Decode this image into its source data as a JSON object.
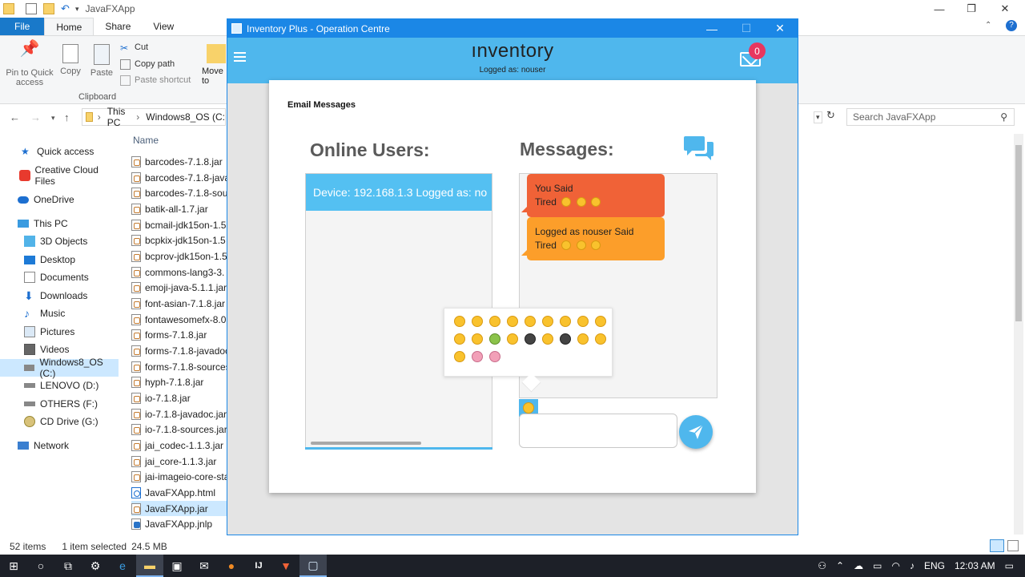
{
  "explorer": {
    "window_title": "JavaFXApp",
    "tabs": [
      {
        "label": "File"
      },
      {
        "label": "Home"
      },
      {
        "label": "Share"
      },
      {
        "label": "View"
      }
    ],
    "ribbon": {
      "pin_label": "Pin to Quick access",
      "copy_label": "Copy",
      "paste_label": "Paste",
      "cut_label": "Cut",
      "copy_path_label": "Copy path",
      "paste_shortcut_label": "Paste shortcut",
      "move_to_label": "Move to",
      "clipboard_group": "Clipboard"
    },
    "address": {
      "crumbs": [
        "This PC",
        "Windows8_OS (C:"
      ],
      "search_placeholder": "Search JavaFXApp"
    },
    "nav_items": [
      {
        "label": "Quick access",
        "icon": "star-icon"
      },
      {
        "label": "Creative Cloud Files",
        "icon": "creative-cloud-icon"
      },
      {
        "label": "OneDrive",
        "icon": "cloud-icon"
      },
      {
        "label": "This PC",
        "icon": "computer-icon"
      },
      {
        "label": "3D Objects",
        "icon": "cube-icon"
      },
      {
        "label": "Desktop",
        "icon": "desktop-icon"
      },
      {
        "label": "Documents",
        "icon": "document-icon"
      },
      {
        "label": "Downloads",
        "icon": "download-icon"
      },
      {
        "label": "Music",
        "icon": "music-icon"
      },
      {
        "label": "Pictures",
        "icon": "picture-icon"
      },
      {
        "label": "Videos",
        "icon": "video-icon"
      },
      {
        "label": "Windows8_OS (C:)",
        "icon": "drive-icon"
      },
      {
        "label": "LENOVO (D:)",
        "icon": "drive-icon"
      },
      {
        "label": "OTHERS (F:)",
        "icon": "drive-icon"
      },
      {
        "label": "CD Drive (G:)",
        "icon": "cd-drive-icon"
      },
      {
        "label": "Network",
        "icon": "network-icon"
      }
    ],
    "column_name": "Name",
    "files": [
      "barcodes-7.1.8.jar",
      "barcodes-7.1.8-java",
      "barcodes-7.1.8-sour",
      "batik-all-1.7.jar",
      "bcmail-jdk15on-1.5",
      "bcpkix-jdk15on-1.5",
      "bcprov-jdk15on-1.5",
      "commons-lang3-3.",
      "emoji-java-5.1.1.jar",
      "font-asian-7.1.8.jar",
      "fontawesomefx-8.0.",
      "forms-7.1.8.jar",
      "forms-7.1.8-javadoc",
      "forms-7.1.8-sources",
      "hyph-7.1.8.jar",
      "io-7.1.8.jar",
      "io-7.1.8-javadoc.jar",
      "io-7.1.8-sources.jar",
      "jai_codec-1.1.3.jar",
      "jai_core-1.1.3.jar",
      "jai-imageio-core-sta",
      "JavaFXApp.html",
      "JavaFXApp.jar",
      "JavaFXApp.jnlp"
    ],
    "status": {
      "items": "52 items",
      "selected": "1 item selected",
      "size": "24.5 MB"
    }
  },
  "taskbar": {
    "language": "ENG",
    "time": "12:03 AM"
  },
  "app": {
    "window_title": "Inventory Plus - Operation Centre",
    "brand": "ınventory",
    "logged_as": "Logged as: nouser",
    "notification_count": "0",
    "card_title": "Email Messages",
    "online_users_title": "Online Users:",
    "messages_title": "Messages:",
    "users": [
      "Device: 192.168.1.3 Logged as: no"
    ],
    "messages": [
      {
        "line1": "You Said",
        "line2": "Tired",
        "color": "#f06237"
      },
      {
        "line1": "Logged as  nouser Said",
        "line2": "Tired",
        "color": "#fc9e2a"
      }
    ],
    "accent_color": "#4fb7ed",
    "title_bar_color": "#1b87e6"
  }
}
